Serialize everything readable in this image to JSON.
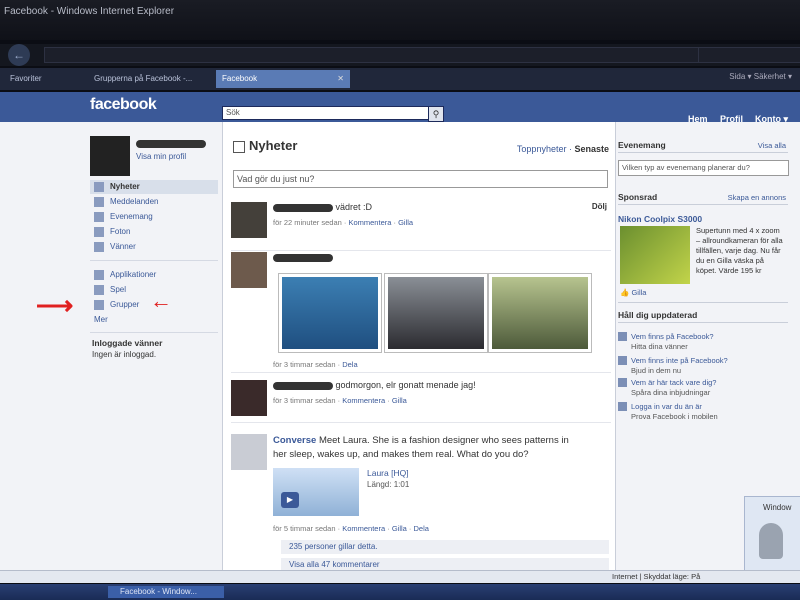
{
  "window": {
    "title": "Facebook - Windows Internet Explorer"
  },
  "browser": {
    "back_icon": "back-arrow-icon",
    "tabs": [
      {
        "label": "Favoriter"
      },
      {
        "label": "Grupperna på Facebook -..."
      },
      {
        "label": "Facebook"
      }
    ],
    "tools": "Sida ▾ Säkerhet ▾"
  },
  "fb": {
    "logo": "facebook",
    "search_placeholder": "Sök",
    "nav": {
      "home": "Hem",
      "profile": "Profil",
      "account": "Konto ▾"
    }
  },
  "left": {
    "view_profile": "Visa min profil",
    "menu": [
      {
        "label": "Nyheter",
        "icon": "news-feed-icon"
      },
      {
        "label": "Meddelanden",
        "icon": "messages-icon"
      },
      {
        "label": "Evenemang",
        "icon": "events-icon"
      },
      {
        "label": "Foton",
        "icon": "photos-icon"
      },
      {
        "label": "Vänner",
        "icon": "friends-icon"
      }
    ],
    "apps": [
      {
        "label": "Applikationer",
        "icon": "applications-icon"
      },
      {
        "label": "Spel",
        "icon": "games-icon"
      },
      {
        "label": "Grupper",
        "icon": "groups-icon"
      }
    ],
    "more": "Mer",
    "online_heading": "Inloggade vänner",
    "online_status": "Ingen är inloggad."
  },
  "main": {
    "heading": "Nyheter",
    "filter_top": "Toppnyheter",
    "filter_recent": "Senaste",
    "status_placeholder": "Vad gör du just nu?",
    "posts": [
      {
        "text": "vädret :D",
        "time": "för 22 minuter sedan",
        "comment": "Kommentera",
        "like": "Gilla",
        "hide": "Dölj"
      },
      {
        "time": "för 3 timmar sedan",
        "share": "Dela"
      },
      {
        "text": "godmorgon, elr gonatt menade jag!",
        "time": "för 3 timmar sedan",
        "comment": "Kommentera",
        "like": "Gilla"
      },
      {
        "brand": "Converse",
        "text": "Meet Laura. She is a fashion designer who sees patterns in her sleep, wakes up, and makes them real. What do you do?",
        "video_title": "Laura [HQ]",
        "video_length": "Längd: 1:01",
        "time": "för 5 timmar sedan",
        "comment": "Kommentera",
        "like": "Gilla",
        "share": "Dela",
        "likes": "235 personer gillar detta.",
        "view_comments": "Visa alla 47 kommentarer"
      }
    ]
  },
  "right": {
    "events_heading": "Evenemang",
    "events_link": "Visa alla",
    "events_placeholder": "Vilken typ av evenemang planerar du?",
    "sponsored_heading": "Sponsrad",
    "sponsored_link": "Skapa en annons",
    "ad_title": "Nikon Coolpix S3000",
    "ad_text": "Supertunn med 4 x zoom – allroundkameran för alla tillfällen, varje dag. Nu får du en Gilla väska på köpet. Värde 195 kr",
    "ad_like": "Gilla",
    "updated_heading": "Håll dig uppdaterad",
    "updates": [
      {
        "title": "Vem finns på Facebook?",
        "sub": "Hitta dina vänner"
      },
      {
        "title": "Vem finns inte på Facebook?",
        "sub": "Bjud in dem nu"
      },
      {
        "title": "Vem är här tack vare dig?",
        "sub": "Spåra dina inbjudningar"
      },
      {
        "title": "Logga in var du än är",
        "sub": "Prova Facebook i mobilen"
      }
    ]
  },
  "statusbar": {
    "zone": "Internet | Skyddat läge: På"
  },
  "taskbar": {
    "task": "Facebook - Window..."
  },
  "popup": {
    "title": "Window"
  }
}
